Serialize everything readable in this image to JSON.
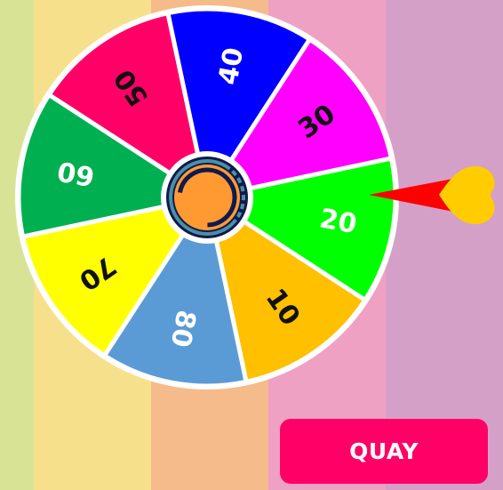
{
  "background": {
    "stripe_colors": [
      "#d8e396",
      "#f7e08c",
      "#f6bb8a",
      "#efa1c3",
      "#d5a0c7"
    ]
  },
  "wheel": {
    "border_color": "#ffffff",
    "segments": [
      {
        "label": "20",
        "color": "#00ff00",
        "text_color": "#ffffff"
      },
      {
        "label": "10",
        "color": "#ffc000",
        "text_color": "#111111"
      },
      {
        "label": "80",
        "color": "#5b9bd5",
        "text_color": "#ffffff"
      },
      {
        "label": "70",
        "color": "#ffff00",
        "text_color": "#111111"
      },
      {
        "label": "60",
        "color": "#00b050",
        "text_color": "#ffffff"
      },
      {
        "label": "50",
        "color": "#ff0066",
        "text_color": "#111111"
      },
      {
        "label": "40",
        "color": "#0000ff",
        "text_color": "#ffffff"
      },
      {
        "label": "30",
        "color": "#ff00ff",
        "text_color": "#111111"
      }
    ],
    "hub": {
      "outer_color": "#ffffff",
      "ring_color": "#0f1a4d",
      "core_color": "#ff9a33",
      "accent_color": "#4a90a4"
    }
  },
  "pointer": {
    "arrow_color": "#ff0000",
    "heart_color": "#ffcc00"
  },
  "spin_button": {
    "label": "QUAY",
    "color": "#ff0066"
  }
}
